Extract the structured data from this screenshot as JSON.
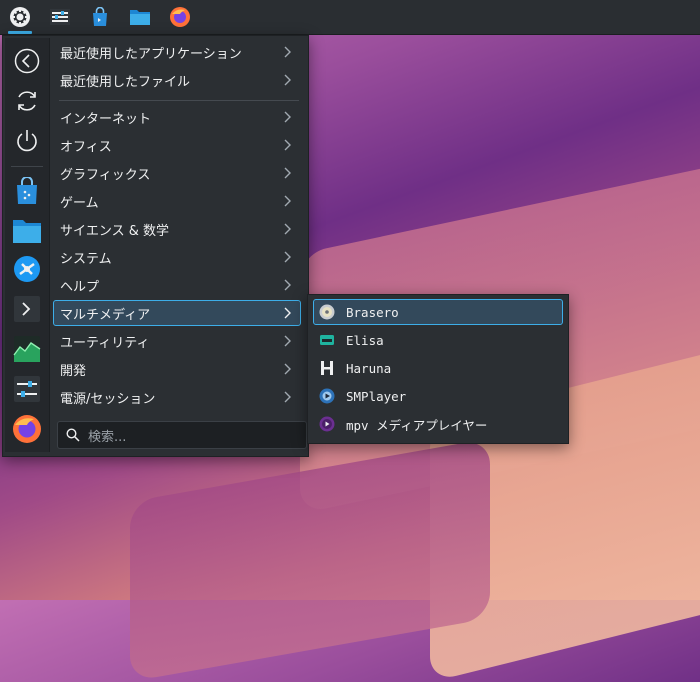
{
  "panel": {
    "apps": [
      "kickoff-launcher",
      "system-settings",
      "discover-store",
      "dolphin-file-manager",
      "firefox"
    ]
  },
  "launcher": {
    "favorites": [
      "back-icon",
      "refresh-icon",
      "power-icon",
      "discover-icon",
      "folder-icon",
      "kde-connect-icon",
      "terminal-icon",
      "system-monitor-icon",
      "settings-icon",
      "firefox-icon"
    ],
    "menu": [
      {
        "label": "最近使用したアプリケーション"
      },
      {
        "label": "最近使用したファイル"
      },
      {
        "label": "インターネット"
      },
      {
        "label": "オフィス"
      },
      {
        "label": "グラフィックス"
      },
      {
        "label": "ゲーム"
      },
      {
        "label": "サイエンス & 数学"
      },
      {
        "label": "システム"
      },
      {
        "label": "ヘルプ"
      },
      {
        "label": "マルチメディア"
      },
      {
        "label": "ユーティリティ"
      },
      {
        "label": "開発"
      },
      {
        "label": "電源/セッション"
      }
    ],
    "search_placeholder": "検索..."
  },
  "submenu": {
    "items": [
      {
        "label": "Brasero",
        "icon": "disc-burner-icon"
      },
      {
        "label": "Elisa",
        "icon": "music-player-icon"
      },
      {
        "label": "Haruna",
        "icon": "video-player-icon"
      },
      {
        "label": "SMPlayer",
        "icon": "media-player-icon"
      },
      {
        "label": "mpv メディアプレイヤー",
        "icon": "mpv-icon"
      }
    ]
  },
  "colors": {
    "accent": "#3daee9",
    "selection_bg": "#33495b",
    "panel_bg": "#2a2e32",
    "menu_bg": "#2b2f33"
  }
}
